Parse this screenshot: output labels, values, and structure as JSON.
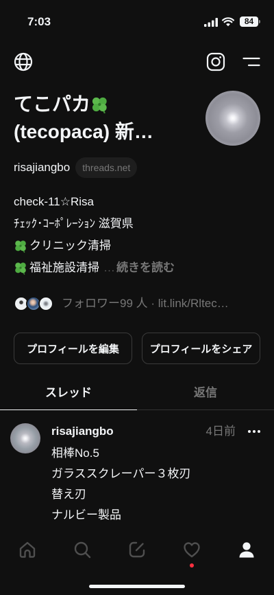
{
  "status_bar": {
    "time": "7:03",
    "battery": "84",
    "icons": [
      "signal-icon",
      "wifi-icon",
      "battery-icon"
    ]
  },
  "header": {
    "icons": [
      "globe-icon",
      "instagram-icon",
      "menu-icon"
    ]
  },
  "profile": {
    "name": {
      "line1": "てこパカ",
      "line1_icon": "clover-icon",
      "line2": "(tecopaca) 新…"
    },
    "username": "risajiangbo",
    "domain_badge": "threads.net",
    "bio": [
      {
        "text": "check-11☆Risa"
      },
      {
        "text": "ﾁｪｯｸ･ｺｰﾎﾟﾚｰｼｮﾝ 滋賀県"
      },
      {
        "icon": "clover-icon",
        "text": "クリニック清掃"
      },
      {
        "icon": "clover-icon",
        "text": "福祉施設清掃"
      }
    ],
    "bio_ellipsis": "…",
    "bio_more": "続きを読む",
    "followers": {
      "label": "フォロワー99 人",
      "separator": "·",
      "link": "lit.link/Rltec…"
    }
  },
  "actions": {
    "edit": "プロフィールを編集",
    "share": "プロフィールをシェア"
  },
  "tabs": [
    {
      "label": "スレッド",
      "active": true
    },
    {
      "label": "返信",
      "active": false
    }
  ],
  "post": {
    "username": "risajiangbo",
    "time": "4日前",
    "more_icon": "more-icon",
    "lines": [
      "相棒No.5",
      "ガラススクレーパー３枚刃",
      "替え刃",
      "ナルビー製品"
    ]
  },
  "bottom_nav": [
    {
      "icon": "home-icon",
      "active": false
    },
    {
      "icon": "search-icon",
      "active": false
    },
    {
      "icon": "compose-icon",
      "active": false
    },
    {
      "icon": "heart-icon",
      "active": false,
      "notification_dot": true
    },
    {
      "icon": "profile-icon",
      "active": true
    }
  ],
  "colors": {
    "background": "#101010",
    "text": "#f3f5f7",
    "secondary_text": "#777777",
    "border": "#333333",
    "notification_dot": "#ff3040"
  }
}
